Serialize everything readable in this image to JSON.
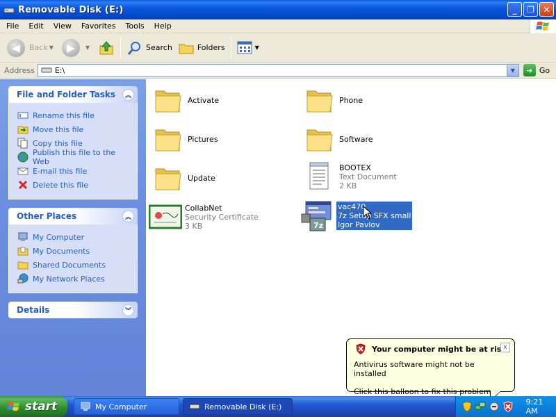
{
  "window": {
    "title": "Removable Disk (E:)"
  },
  "menu": [
    "File",
    "Edit",
    "View",
    "Favorites",
    "Tools",
    "Help"
  ],
  "toolbar": {
    "back": "Back",
    "search": "Search",
    "folders": "Folders"
  },
  "address": {
    "label": "Address",
    "value": "E:\\",
    "go": "Go"
  },
  "tasks_panel": {
    "title": "File and Folder Tasks",
    "items": [
      {
        "label": "Rename this file",
        "icon": "rename-icon"
      },
      {
        "label": "Move this file",
        "icon": "move-icon"
      },
      {
        "label": "Copy this file",
        "icon": "copy-icon"
      },
      {
        "label": "Publish this file to the Web",
        "icon": "globe-icon"
      },
      {
        "label": "E-mail this file",
        "icon": "email-icon"
      },
      {
        "label": "Delete this file",
        "icon": "delete-icon"
      }
    ]
  },
  "places_panel": {
    "title": "Other Places",
    "items": [
      {
        "label": "My Computer",
        "icon": "computer-icon"
      },
      {
        "label": "My Documents",
        "icon": "documents-folder-icon"
      },
      {
        "label": "Shared Documents",
        "icon": "shared-folder-icon"
      },
      {
        "label": "My Network Places",
        "icon": "network-icon"
      }
    ]
  },
  "details_panel": {
    "title": "Details"
  },
  "files": [
    {
      "name": "Activate",
      "icon": "folder-icon"
    },
    {
      "name": "Phone",
      "icon": "folder-icon"
    },
    {
      "name": "Pictures",
      "icon": "folder-icon"
    },
    {
      "name": "Software",
      "icon": "folder-icon"
    },
    {
      "name": "Update",
      "icon": "folder-icon"
    },
    {
      "name": "BOOTEX",
      "type": "Text Document",
      "size": "2 KB",
      "icon": "text-document-icon"
    },
    {
      "name": "CollabNet",
      "type": "Security Certificate",
      "size": "3 KB",
      "icon": "certificate-icon"
    },
    {
      "name": "vac470",
      "type": "7z Setup SFX small",
      "size": "Igor Pavlov",
      "icon": "7z-installer-icon",
      "selected": true
    }
  ],
  "balloon": {
    "title": "Your computer might be at risk",
    "line1": "Antivirus software might not be installed",
    "line2": "Click this balloon to fix this problem.",
    "close": "x"
  },
  "taskbar": {
    "start": "start",
    "buttons": [
      {
        "label": "My Computer",
        "active": false
      },
      {
        "label": "Removable Disk (E:)",
        "active": true
      }
    ],
    "clock": "9:21 AM"
  },
  "colors": {
    "titlebar": "#0a59df",
    "selection": "#316ac5",
    "taskpane": "#6b8ee0",
    "link": "#215dc6"
  }
}
